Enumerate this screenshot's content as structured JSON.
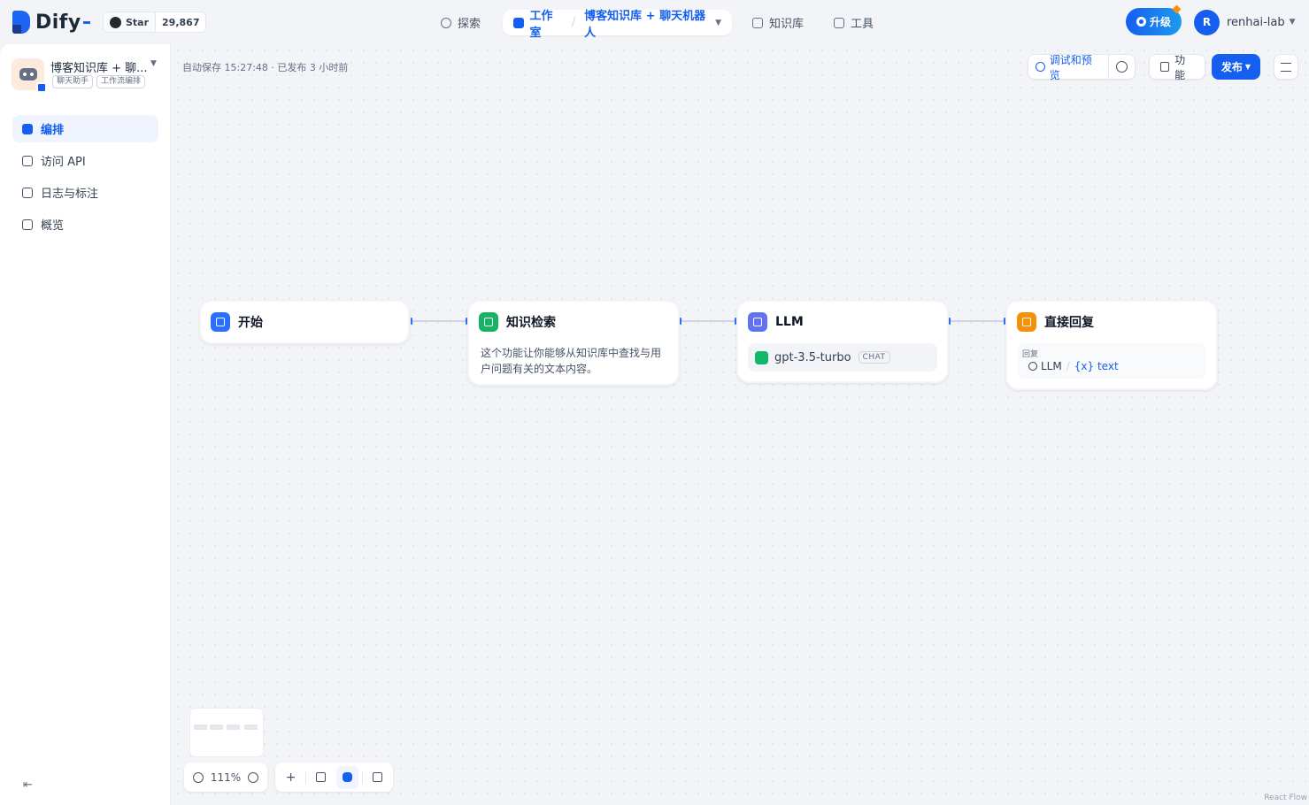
{
  "header": {
    "logo_text": "Dify",
    "github": {
      "star_label": "Star",
      "star_count": "29,867"
    },
    "nav": {
      "explore": "探索",
      "studio": "工作室",
      "current_app": "博客知识库 + 聊天机器人",
      "knowledge": "知识库",
      "tools": "工具"
    },
    "upgrade_label": "升级",
    "user": {
      "initial": "R",
      "name": "renhai-lab"
    }
  },
  "sidebar": {
    "app_name": "博客知识库 + 聊...",
    "tags": [
      "聊天助手",
      "工作流编排"
    ],
    "items": [
      {
        "label": "编排",
        "icon": "edit-icon",
        "active": true
      },
      {
        "label": "访问 API",
        "icon": "terminal-icon",
        "active": false
      },
      {
        "label": "日志与标注",
        "icon": "log-icon",
        "active": false
      },
      {
        "label": "概览",
        "icon": "chart-icon",
        "active": false
      }
    ]
  },
  "toolbar": {
    "autosave": "自动保存 15:27:48 · 已发布 3 小时前",
    "debug_preview": "调试和预览",
    "features": "功能",
    "publish": "发布"
  },
  "nodes": {
    "start": {
      "title": "开始"
    },
    "knowledge_retrieval": {
      "title": "知识检索",
      "description": "这个功能让你能够从知识库中查找与用户问题有关的文本内容。"
    },
    "llm": {
      "title": "LLM",
      "model": "gpt-3.5-turbo",
      "mode": "CHAT"
    },
    "answer": {
      "title": "直接回复",
      "reply_label": "回复",
      "ref_node": "LLM",
      "ref_var": "{x} text"
    }
  },
  "controls": {
    "zoom": "111%"
  },
  "footer": {
    "attribution": "React Flow"
  },
  "colors": {
    "accent": "#155eef",
    "start": "#2970ff",
    "retrieval": "#16b364",
    "llm": "#6172f3",
    "answer": "#f79009"
  }
}
